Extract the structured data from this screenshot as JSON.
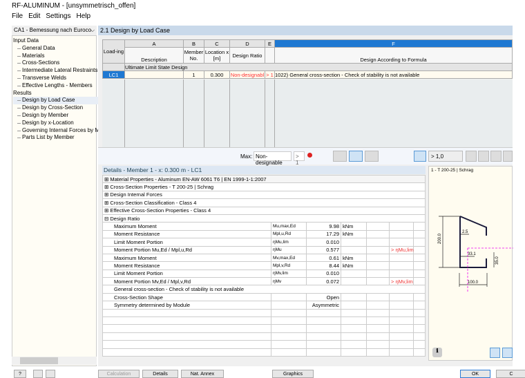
{
  "window": {
    "title": "RF-ALUMINUM - [unsymmetrisch_offen]"
  },
  "menu": [
    "File",
    "Edit",
    "Settings",
    "Help"
  ],
  "sidebar": {
    "case_select": "CA1 - Bemessung nach Euroco",
    "input_header": "Input Data",
    "input_items": [
      "General Data",
      "Materials",
      "Cross-Sections",
      "Intermediate Lateral Restraints",
      "Transverse Welds",
      "Effective Lengths - Members"
    ],
    "results_header": "Results",
    "results_items": [
      "Design by Load Case",
      "Design by Cross-Section",
      "Design by Member",
      "Design by x-Location",
      "Governing Internal Forces by M",
      "Parts List by Member"
    ]
  },
  "main": {
    "title": "2.1 Design by Load Case",
    "columns": {
      "letters": [
        "A",
        "B",
        "C",
        "D",
        "E",
        "F"
      ],
      "loading": "Load-ing",
      "description": "Description",
      "member": "Member No.",
      "location": "Location x [m]",
      "ratio": "Design Ratio",
      "formula": "Design According to Formula"
    },
    "group_row": "Ultimate Limit State Design",
    "rows": [
      {
        "loading": "LC1",
        "description": "",
        "member": "1",
        "location": "0.300",
        "ratio": "Non-designabl",
        "flag": "> 1",
        "formula": "1022) General cross-section  - Check of stability is not available"
      }
    ],
    "max_label": "Max:",
    "max_value": "Non-designable",
    "max_flag": "> 1",
    "filter": "> 1,0"
  },
  "details": {
    "title": "Details - Member 1 - x: 0.300 m - LC1",
    "sections": [
      "Material Properties - Aluminum EN-AW 6061 T6 | EN 1999-1-1:2007",
      "Cross-Section Properties -  T 200-25 | Schrag",
      "Design Internal Forces",
      "Cross-Section Classification - Class 4",
      "Effective Cross-Section Properties - Class 4",
      "Design Ratio"
    ],
    "rows": [
      {
        "name": "Maximum Moment",
        "symbol": "Mu,max,Ed",
        "value": "9.98",
        "unit": "kNm",
        "note": ""
      },
      {
        "name": "Moment Resistance",
        "symbol": "Mpl,u,Rd",
        "value": "17.29",
        "unit": "kNm",
        "note": ""
      },
      {
        "name": "Limit Moment Portion",
        "symbol": "ηMu,lim",
        "value": "0.010",
        "unit": "",
        "note": ""
      },
      {
        "name": "Moment Portion Mu,Ed / Mpl,u,Rd",
        "symbol": "ηMu",
        "value": "0.577",
        "unit": "",
        "note": "> ηMu,lim"
      },
      {
        "name": "Maximum Moment",
        "symbol": "Mv,max,Ed",
        "value": "0.61",
        "unit": "kNm",
        "note": ""
      },
      {
        "name": "Moment Resistance",
        "symbol": "Mpl,v,Rd",
        "value": "8.44",
        "unit": "kNm",
        "note": ""
      },
      {
        "name": "Limit Moment Portion",
        "symbol": "ηMv,lim",
        "value": "0.010",
        "unit": "",
        "note": ""
      },
      {
        "name": "Moment Portion Mv,Ed / Mpl,v,Rd",
        "symbol": "ηMv",
        "value": "0.072",
        "unit": "",
        "note": "> ηMv,lim"
      }
    ],
    "message": "General cross-section - Check of stability is not available",
    "shape_label": "Cross-Section Shape",
    "shape_value": "Open",
    "sym_label": "Symmetry determined by Module",
    "sym_value": "Asymmetric"
  },
  "graphic": {
    "title": "1 - T 200-25 | Schrag",
    "dims": [
      "200.0",
      "2.5",
      "33.1",
      "35.0",
      "100.0"
    ]
  },
  "buttons": {
    "calculation": "Calculation",
    "details": "Details",
    "nat_annex": "Nat. Annex",
    "graphics": "Graphics",
    "ok": "OK",
    "cancel": "C"
  }
}
